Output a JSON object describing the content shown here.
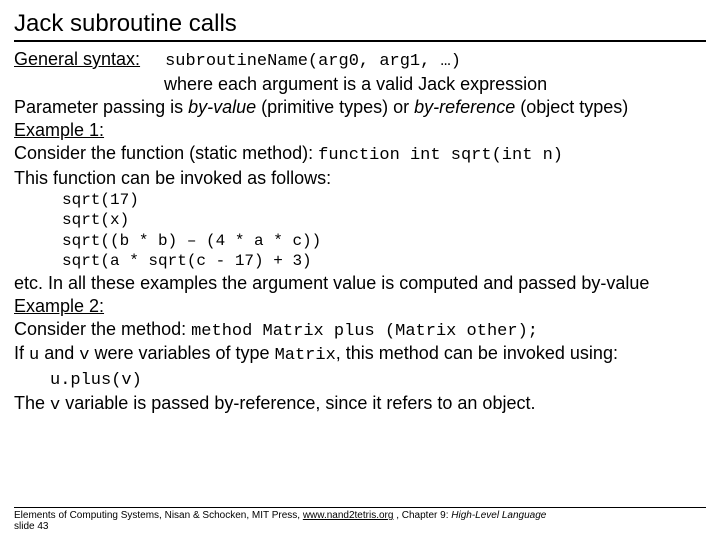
{
  "title": "Jack subroutine calls",
  "general_syntax_label": "General syntax:",
  "general_syntax_code": "subroutineName(arg0, arg1, …)",
  "general_syntax_tail": "where each argument is a valid Jack expression",
  "param_passing_a": "Parameter passing is ",
  "by_value": "by-value",
  "param_passing_b": " (primitive types) or ",
  "by_reference": "by-reference",
  "param_passing_c": " (object types)",
  "example1_label": "Example 1:",
  "consider_fn_a": "Consider the function (static method):   ",
  "fn_sig": "function int sqrt(int n)",
  "invoke_as": "This function can be invoked as follows:",
  "calls": {
    "c0": "sqrt(17)",
    "c1": "sqrt(x)",
    "c2": "sqrt((b * b) – (4 * a * c))",
    "c3": "sqrt(a * sqrt(c - 17) + 3)"
  },
  "etc_line": "etc.  In all these examples the argument value is computed and passed by-value",
  "example2_label": "Example 2:",
  "consider_method_a": "Consider the method:   ",
  "method_sig": "method Matrix plus (Matrix other);",
  "uv_line": {
    "a": "If ",
    "u": "u",
    "b": " and ",
    "v": "v",
    "c": " were variables of type ",
    "matrix": "Matrix",
    "d": ", this method can be invoked using:  ",
    "call": "u.plus(v)"
  },
  "vpass": {
    "a": "The ",
    "v": "v",
    "b": " variable is passed by-reference, since it refers to an object."
  },
  "footer": {
    "a": "Elements of Computing Systems, Nisan & Schocken, MIT Press, ",
    "link": "www.nand2tetris.org",
    "b": " , Chapter 9: ",
    "c": "High-Level Language",
    "slide": "slide 43"
  }
}
